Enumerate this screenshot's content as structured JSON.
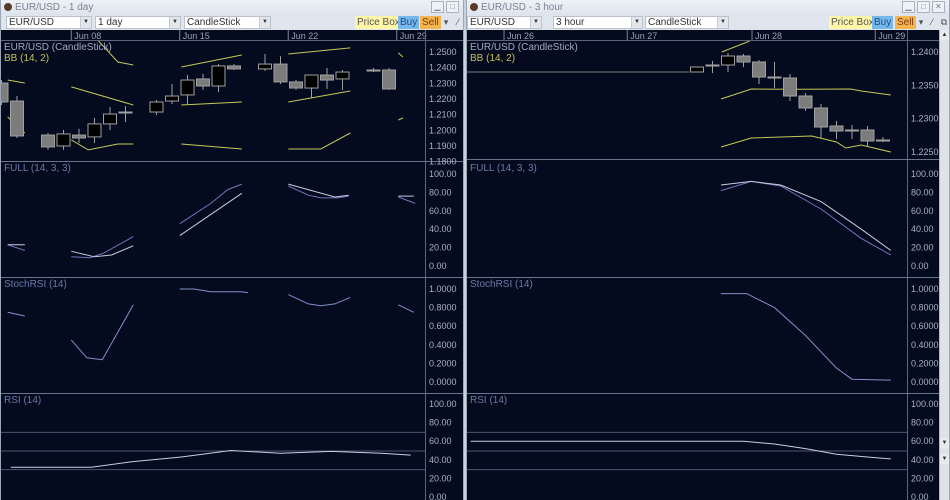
{
  "windows": [
    {
      "title": "EUR/USD - 1 day",
      "symbol": "EUR/USD",
      "interval": "1 day",
      "chart_type": "CandleStick",
      "buttons": {
        "price_box": "Price Box",
        "buy": "Buy",
        "sell": "Sell"
      },
      "controls": [
        "minimize",
        "maximize"
      ],
      "date_ticks": [
        {
          "label": "Jun 08",
          "at": 7.5
        },
        {
          "label": "Jun 15",
          "at": 14.5
        },
        {
          "label": "Jun 22",
          "at": 21.5
        },
        {
          "label": "Jun 29",
          "at": 28.5
        }
      ],
      "price": {
        "label": "EUR/USD (CandleStick)",
        "bb_label": "BB (14, 2)",
        "ylim": [
          1.181,
          1.2577
        ],
        "ticks": [
          "1.2500",
          "1.2400",
          "1.2300",
          "1.2200",
          "1.2100",
          "1.2000",
          "1.1900",
          "1.1800"
        ],
        "candles": [
          [
            3,
            1.2302,
            1.2181,
            1.2321,
            1.2162
          ],
          [
            4,
            1.2187,
            1.1964,
            1.2219,
            1.1951
          ],
          [
            6,
            1.197,
            1.1894,
            1.1983,
            1.1875
          ],
          [
            7,
            1.19,
            1.1977,
            1.2002,
            1.1875
          ],
          [
            8,
            1.197,
            1.1951,
            1.2009,
            1.1919
          ],
          [
            9,
            1.1958,
            1.2041,
            1.2079,
            1.1919
          ],
          [
            10,
            1.2041,
            1.2104,
            1.2149,
            1.2002
          ],
          [
            11,
            1.2111,
            1.2117,
            1.2155,
            1.2053
          ],
          [
            13,
            1.2117,
            1.2181,
            1.2194,
            1.2098
          ],
          [
            14,
            1.2187,
            1.2219,
            1.2296,
            1.2168
          ],
          [
            15,
            1.2226,
            1.2321,
            1.2353,
            1.2168
          ],
          [
            16,
            1.2328,
            1.2283,
            1.236,
            1.2258
          ],
          [
            17,
            1.2283,
            1.2411,
            1.2423,
            1.2245
          ],
          [
            18,
            1.2411,
            1.2392,
            1.2423,
            1.2385
          ],
          [
            20,
            1.2392,
            1.2423,
            1.2487,
            1.2379
          ],
          [
            21,
            1.2423,
            1.2309,
            1.2474,
            1.2296
          ],
          [
            22,
            1.2309,
            1.227,
            1.2321,
            1.2258
          ],
          [
            23,
            1.227,
            1.2353,
            1.2353,
            1.2207
          ],
          [
            24,
            1.2353,
            1.2321,
            1.2398,
            1.2264
          ],
          [
            25,
            1.2328,
            1.2372,
            1.2385,
            1.2258
          ],
          [
            27,
            1.2385,
            1.2379,
            1.2398,
            1.2372
          ],
          [
            28,
            1.2385,
            1.2264,
            1.2398,
            1.2258
          ]
        ],
        "flat": [],
        "bb": {
          "upper": [
            [
              [
                3.4,
                1.2321
              ],
              [
                4.5,
                1.2302
              ]
            ],
            [
              [
                9.2,
                1.2577
              ],
              [
                10.5,
                1.2436
              ],
              [
                11.5,
                1.2417
              ]
            ],
            [
              [
                14.6,
                1.2404
              ],
              [
                18.5,
                1.2481
              ]
            ],
            [
              [
                21.5,
                1.2487
              ],
              [
                25.5,
                1.2526
              ]
            ],
            [
              [
                28.6,
                1.2494
              ],
              [
                28.9,
                1.2468
              ]
            ]
          ],
          "middle": [
            [
              [
                3.4,
                1.2085
              ],
              [
                4.5,
                1.1983
              ]
            ],
            [
              [
                7.5,
                1.2277
              ],
              [
                11.5,
                1.2162
              ]
            ],
            [
              [
                14.6,
                1.2162
              ],
              [
                18.5,
                1.2181
              ]
            ],
            [
              [
                21.5,
                1.2181
              ],
              [
                25.5,
                1.2251
              ]
            ],
            [
              [
                28.6,
                1.2066
              ],
              [
                28.9,
                1.2079
              ]
            ]
          ],
          "lower": [
            [
              [
                7.5,
                1.1939
              ],
              [
                8.6,
                1.1875
              ],
              [
                10.5,
                1.1913
              ],
              [
                11.5,
                1.1913
              ]
            ],
            [
              [
                14.6,
                1.1913
              ],
              [
                18.5,
                1.1881
              ]
            ],
            [
              [
                21.5,
                1.1881
              ],
              [
                23.6,
                1.1881
              ],
              [
                25.5,
                1.1983
              ]
            ]
          ]
        }
      },
      "full": {
        "label": "FULL (14, 3, 3)",
        "ticks": [
          "100.00",
          "80.00",
          "60.00",
          "40.00",
          "20.00",
          "0.00"
        ],
        "line1": [
          [
            [
              3.4,
              23
            ],
            [
              4.5,
              23
            ]
          ],
          [
            [
              7.5,
              16
            ],
            [
              9,
              10
            ],
            [
              10.1,
              12
            ],
            [
              11.5,
              22
            ]
          ],
          [
            [
              14.5,
              33
            ],
            [
              18.5,
              79
            ]
          ],
          [
            [
              21.5,
              89
            ],
            [
              24.5,
              75
            ],
            [
              25.4,
              77
            ]
          ],
          [
            [
              28.6,
              76
            ],
            [
              29.6,
              76
            ]
          ]
        ],
        "line2": [
          [
            [
              3.4,
              23
            ],
            [
              4.5,
              17
            ]
          ],
          [
            [
              7.5,
              10
            ],
            [
              8.7,
              9
            ],
            [
              9.6,
              14
            ],
            [
              11.5,
              32
            ]
          ],
          [
            [
              14.5,
              46
            ],
            [
              16.5,
              68
            ],
            [
              17.6,
              83
            ],
            [
              18.5,
              89
            ]
          ],
          [
            [
              21.5,
              87
            ],
            [
              22.8,
              77
            ],
            [
              23.6,
              74
            ],
            [
              24.7,
              74
            ],
            [
              25.4,
              76
            ]
          ],
          [
            [
              28.6,
              75
            ],
            [
              29.7,
              68
            ]
          ]
        ]
      },
      "stoch": {
        "label": "StochRSI (14)",
        "ticks": [
          "1.0000",
          "0.8000",
          "0.6000",
          "0.4000",
          "0.2000",
          "0.0000"
        ],
        "line": [
          [
            [
              3.4,
              0.75
            ],
            [
              4.5,
              0.71
            ]
          ],
          [
            [
              7.5,
              0.45
            ],
            [
              8.5,
              0.26
            ],
            [
              9.5,
              0.24
            ],
            [
              11.5,
              0.83
            ]
          ],
          [
            [
              14.5,
              1.0
            ],
            [
              15.4,
              1.0
            ],
            [
              16.5,
              0.97
            ],
            [
              18.5,
              0.97
            ],
            [
              18.9,
              0.96
            ]
          ],
          [
            [
              21.5,
              0.94
            ],
            [
              22.8,
              0.84
            ],
            [
              23.6,
              0.82
            ],
            [
              24.5,
              0.84
            ],
            [
              25.5,
              0.91
            ]
          ],
          [
            [
              28.6,
              0.83
            ],
            [
              29.6,
              0.75
            ]
          ]
        ]
      },
      "rsi": {
        "label": "RSI (14)",
        "ticks": [
          "100.00",
          "80.00",
          "60.00",
          "40.00",
          "20.00",
          "0.00"
        ],
        "levels": [
          70,
          50,
          30
        ],
        "line": [
          [
            [
              3.6,
              32
            ],
            [
              8.8,
              32
            ],
            [
              11.4,
              38
            ],
            [
              14.6,
              43
            ],
            [
              17.8,
              50
            ],
            [
              21,
              47
            ],
            [
              24.3,
              49
            ],
            [
              27.5,
              47
            ],
            [
              29.4,
              45
            ]
          ]
        ]
      }
    },
    {
      "title": "EUR/USD - 3 hour",
      "symbol": "EUR/USD",
      "interval": "3 hour",
      "chart_type": "CandleStick",
      "buttons": {
        "price_box": "Price Box",
        "buy": "Buy",
        "sell": "Sell"
      },
      "controls": [
        "minimize",
        "maximize",
        "close"
      ],
      "date_ticks": [
        {
          "label": "Jun 26",
          "at": -12.45
        },
        {
          "label": "Jun 27",
          "at": -4.5
        },
        {
          "label": "Jun 28",
          "at": 3.55
        },
        {
          "label": "Jun 29",
          "at": 11.5
        }
      ],
      "price": {
        "label": "EUR/USD (CandleStick)",
        "bb_label": "BB (14, 2)",
        "ylim": [
          1.2241,
          1.2418
        ],
        "ticks": [
          "1.2400",
          "1.2350",
          "1.2300",
          "1.2250"
        ],
        "candles": [
          [
            0,
            1.237,
            1.23775,
            1.23775,
            1.237
          ],
          [
            1,
            1.2379,
            1.23805,
            1.23865,
            1.23685
          ],
          [
            2,
            1.23805,
            1.2394,
            1.23985,
            1.237
          ],
          [
            3,
            1.2394,
            1.2385,
            1.2397,
            1.23775
          ],
          [
            4,
            1.2385,
            1.23625,
            1.2388,
            1.2352
          ],
          [
            5,
            1.23625,
            1.2361,
            1.2385,
            1.2346
          ],
          [
            6,
            1.2361,
            1.2334,
            1.2367,
            1.23265
          ],
          [
            7,
            1.2334,
            1.2316,
            1.23385,
            1.23115
          ],
          [
            8,
            1.2316,
            1.22875,
            1.2322,
            1.2271
          ],
          [
            9,
            1.2289,
            1.22815,
            1.22965,
            1.22695
          ],
          [
            10,
            1.2283,
            1.22815,
            1.22905,
            1.22695
          ],
          [
            11,
            1.2283,
            1.22665,
            1.2289,
            1.22575
          ],
          [
            12,
            1.2268,
            1.22665,
            1.22725,
            1.2265
          ]
        ],
        "flat": [
          [
            -15,
            1.237
          ],
          [
            -0.5,
            1.237
          ]
        ],
        "bb": {
          "upper": [
            [
              [
                1.6,
                1.24
              ],
              [
                3.4,
                1.24165
              ]
            ]
          ],
          "middle": [
            [
              [
                1.55,
                1.23295
              ],
              [
                3.5,
                1.23445
              ],
              [
                6.7,
                1.2344
              ],
              [
                9.9,
                1.23445
              ],
              [
                10.6,
                1.23415
              ],
              [
                12.5,
                1.23355
              ]
            ]
          ],
          "lower": [
            [
              [
                1.55,
                1.22575
              ],
              [
                3.5,
                1.2271
              ],
              [
                7.4,
                1.2274
              ],
              [
                9,
                1.2265
              ],
              [
                9.6,
                1.2256
              ],
              [
                10.6,
                1.22605
              ],
              [
                12.5,
                1.225
              ]
            ]
          ]
        }
      },
      "full": {
        "label": "FULL (14, 3, 3)",
        "ticks": [
          "100.00",
          "80.00",
          "60.00",
          "40.00",
          "20.00",
          "0.00"
        ],
        "line1": [
          [
            [
              1.55,
              88
            ],
            [
              3.5,
              92
            ],
            [
              5.4,
              88
            ],
            [
              8,
              70
            ],
            [
              10.6,
              40
            ],
            [
              12.5,
              17
            ]
          ]
        ],
        "line2": [
          [
            [
              1.55,
              82
            ],
            [
              3.5,
              92
            ],
            [
              5.4,
              87
            ],
            [
              8,
              62
            ],
            [
              10.6,
              30
            ],
            [
              12.5,
              12
            ]
          ]
        ]
      },
      "stoch": {
        "label": "StochRSI (14)",
        "ticks": [
          "1.0000",
          "0.8000",
          "0.6000",
          "0.4000",
          "0.2000",
          "0.0000"
        ],
        "line": [
          [
            [
              1.55,
              0.95
            ],
            [
              3.2,
              0.95
            ],
            [
              5,
              0.8
            ],
            [
              7,
              0.5
            ],
            [
              9,
              0.15
            ],
            [
              10,
              0.03
            ],
            [
              12.5,
              0.02
            ]
          ]
        ]
      },
      "rsi": {
        "label": "RSI (14)",
        "ticks": [
          "100.00",
          "80.00",
          "60.00",
          "40.00",
          "20.00",
          "0.00"
        ],
        "levels": [
          70,
          50,
          30
        ],
        "line": [
          [
            [
              -14.6,
              60
            ],
            [
              3,
              60
            ],
            [
              5,
              57
            ],
            [
              7,
              52
            ],
            [
              9,
              46
            ],
            [
              11,
              43
            ],
            [
              12.5,
              41
            ]
          ]
        ]
      }
    }
  ],
  "colors": {
    "background": "#050b1e",
    "bb": "#c4c85a",
    "bull_body": "#000000",
    "bear_body": "#7c7c7c",
    "osc_line1": "#c8cee0",
    "osc_line2": "#6a78b8"
  }
}
